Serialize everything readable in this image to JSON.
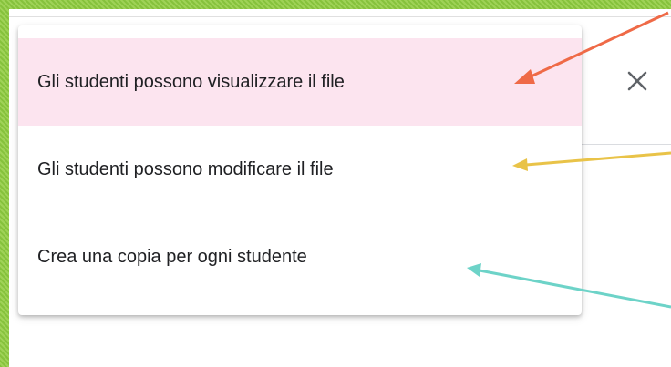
{
  "menu": {
    "items": [
      {
        "label": "Gli studenti possono visualizzare il file",
        "selected": true
      },
      {
        "label": "Gli studenti possono modificare il file",
        "selected": false
      },
      {
        "label": "Crea una copia per ogni studente",
        "selected": false
      }
    ]
  },
  "close_icon": "close-icon",
  "colors": {
    "frame": "#8cc640",
    "selected_bg": "#fce4ef",
    "arrow_view": "#ef6a47",
    "arrow_edit": "#e9c348",
    "arrow_copy": "#6dd3c8"
  }
}
